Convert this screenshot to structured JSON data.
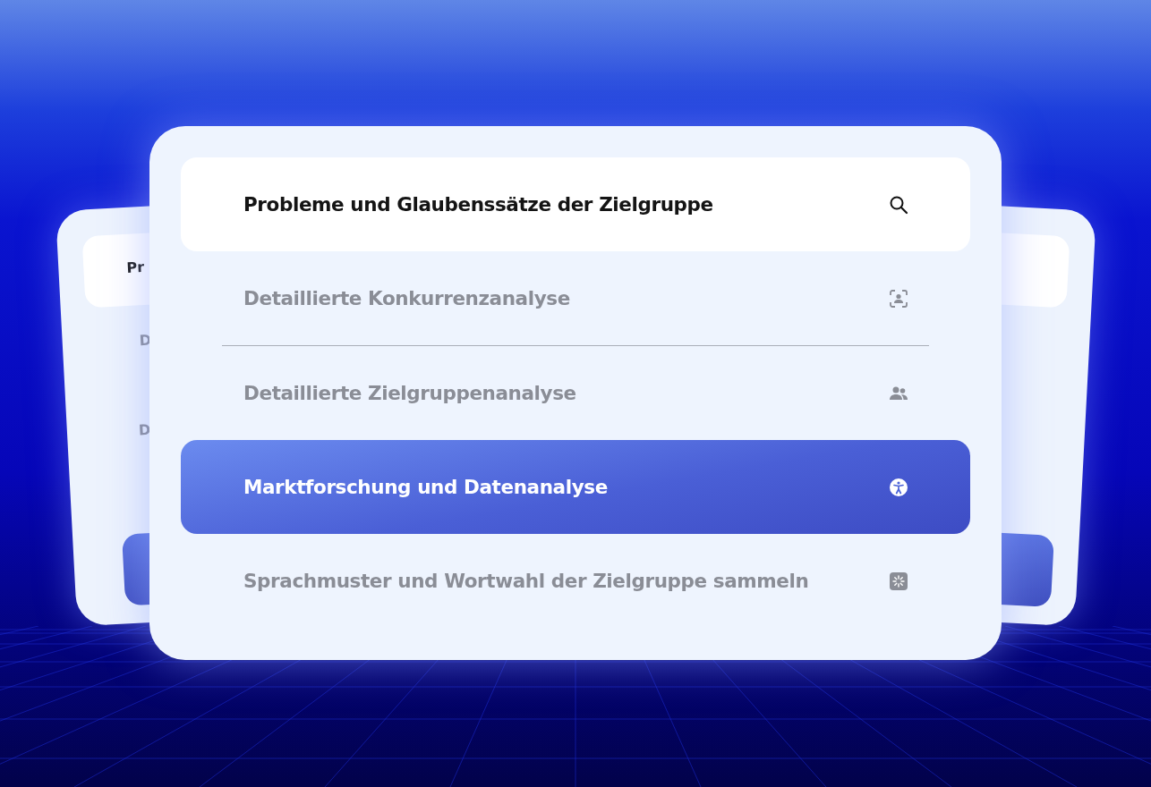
{
  "back_card": {
    "texts": [
      "Pr",
      "D",
      "D"
    ]
  },
  "menu": {
    "items": [
      {
        "label": "Probleme und Glaubenssätze der Zielgruppe",
        "highlighted": true,
        "selected": false,
        "divider_after": false
      },
      {
        "label": "Detaillierte Konkurrenzanalyse",
        "highlighted": false,
        "selected": false,
        "divider_after": true
      },
      {
        "label": "Detaillierte Zielgruppenanalyse",
        "highlighted": false,
        "selected": false,
        "divider_after": false
      },
      {
        "label": "Marktforschung und Datenanalyse",
        "highlighted": false,
        "selected": true,
        "divider_after": false
      },
      {
        "label": "Sprachmuster und Wortwahl der Zielgruppe sammeln",
        "highlighted": false,
        "selected": false,
        "divider_after": false
      }
    ]
  }
}
